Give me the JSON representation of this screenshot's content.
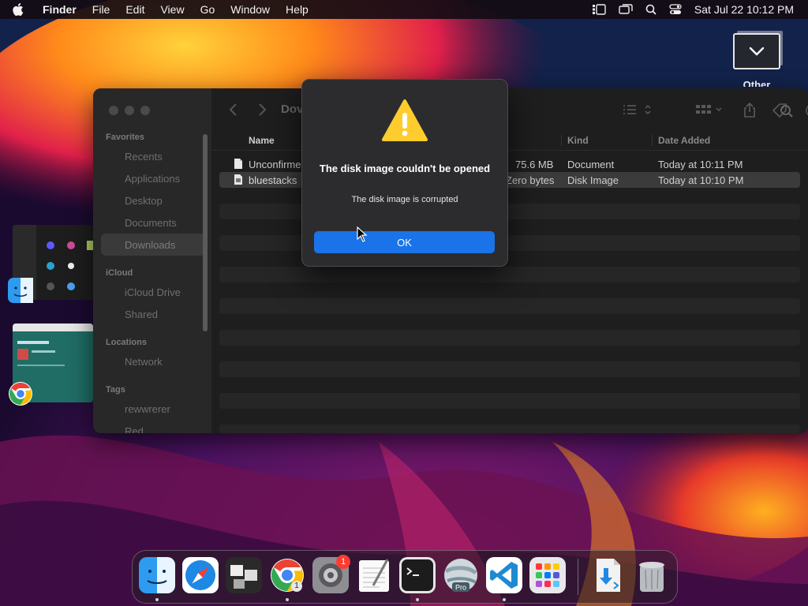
{
  "menubar": {
    "app": "Finder",
    "items": [
      "File",
      "Edit",
      "View",
      "Go",
      "Window",
      "Help"
    ],
    "clock": "Sat Jul 22  10:12 PM"
  },
  "desktop": {
    "other_label": "Other"
  },
  "finder": {
    "title": "Dov",
    "sidebar": {
      "favorites": "Favorites",
      "recents": "Recents",
      "applications": "Applications",
      "desktop": "Desktop",
      "documents": "Documents",
      "downloads": "Downloads",
      "icloud": "iCloud",
      "icloud_drive": "iCloud Drive",
      "shared": "Shared",
      "locations": "Locations",
      "network": "Network",
      "tags": "Tags",
      "tag1": "rewwrerer",
      "tag2": "Red"
    },
    "columns": {
      "name": "Name",
      "kind": "Kind",
      "date_added": "Date Added"
    },
    "files": [
      {
        "name": "Unconfirme",
        "size": "75.6 MB",
        "kind": "Document",
        "date": "Today at 10:11 PM"
      },
      {
        "name": "bluestacks",
        "size": "Zero bytes",
        "kind": "Disk Image",
        "date": "Today at 10:10 PM"
      }
    ]
  },
  "dialog": {
    "title": "The disk image couldn't be opened",
    "message": "The disk image is corrupted",
    "ok_label": "OK"
  },
  "dock": {
    "system_settings_badge": "1",
    "chrome_badge": "1",
    "earth_label": "Pro"
  }
}
